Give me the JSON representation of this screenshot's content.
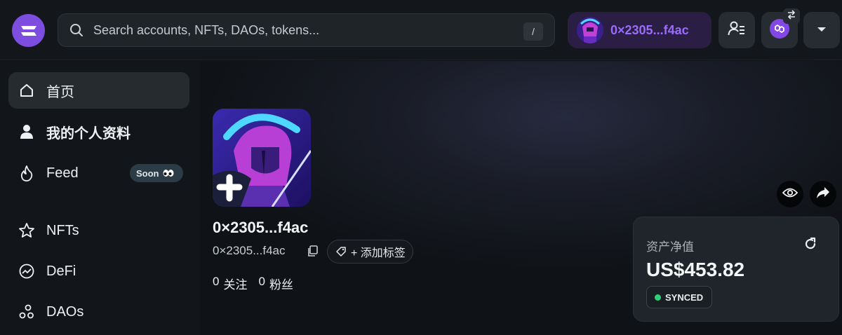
{
  "header": {
    "search_placeholder": "Search accounts, NFTs, DAOs, tokens...",
    "search_shortcut": "/",
    "account_address": "0×2305...f4ac"
  },
  "sidebar": {
    "items": [
      {
        "label": "首页",
        "icon": "home-icon",
        "active": true
      },
      {
        "label": "我的个人资料",
        "icon": "user-icon",
        "active": false
      },
      {
        "label": "Feed",
        "icon": "flame-icon",
        "badge": "Soon",
        "active": false
      },
      {
        "label": "NFTs",
        "icon": "star-icon",
        "active": false
      },
      {
        "label": "DeFi",
        "icon": "chart-circle-icon",
        "active": false
      },
      {
        "label": "DAOs",
        "icon": "dao-circles-icon",
        "active": false
      }
    ]
  },
  "profile": {
    "name": "0×2305...f4ac",
    "address": "0×2305...f4ac",
    "add_tag_label": "+ 添加标签",
    "following_count": "0",
    "following_label": "关注",
    "followers_count": "0",
    "followers_label": "粉丝"
  },
  "networth": {
    "title": "资产净值",
    "value": "US$453.82",
    "status": "SYNCED"
  },
  "colors": {
    "brand_purple": "#7c4ddf",
    "address_purple": "#9b6bff",
    "synced_green": "#2fd07a"
  }
}
